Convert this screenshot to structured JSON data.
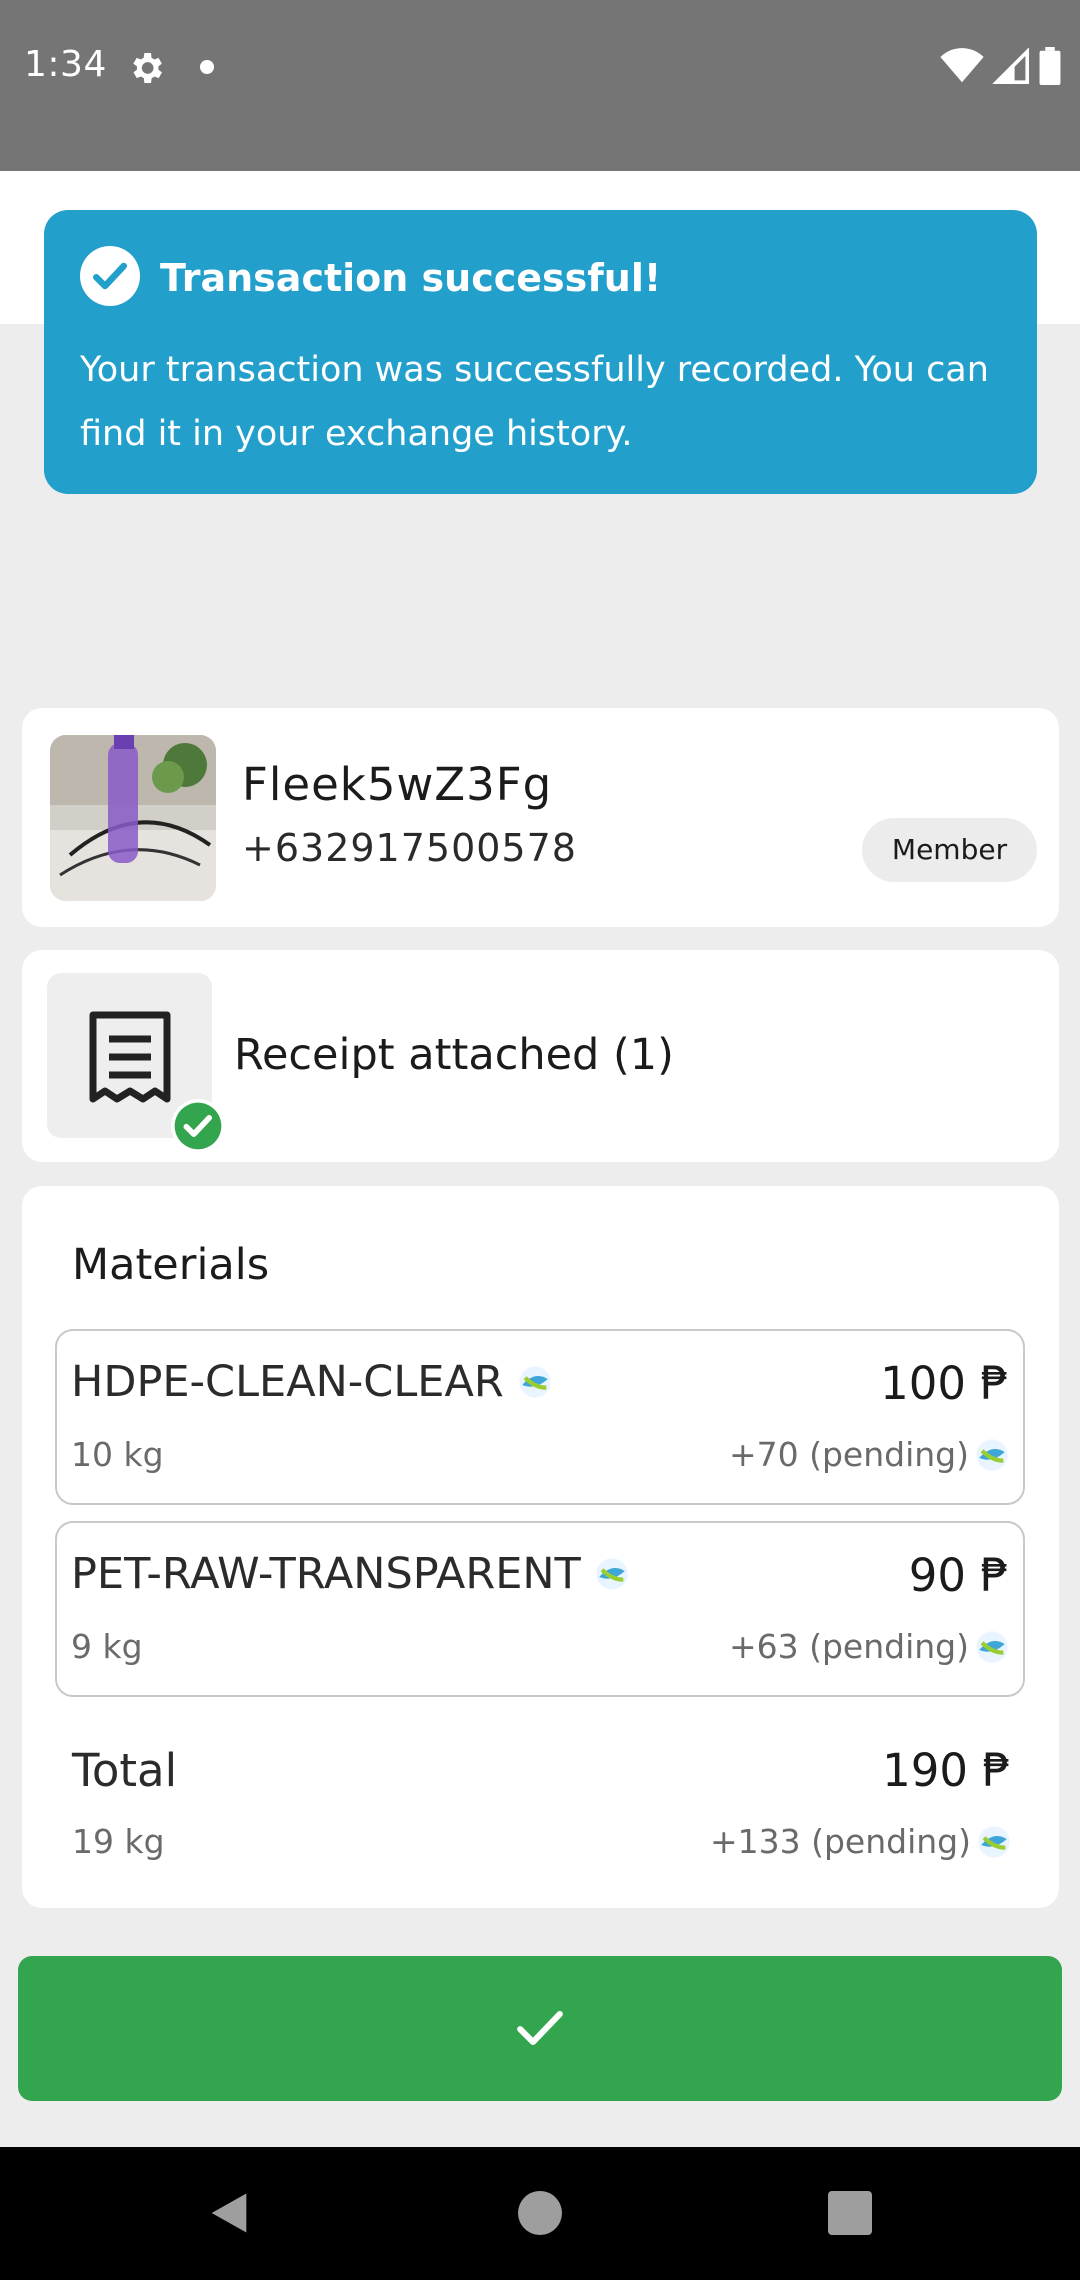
{
  "status_bar": {
    "time": "1:34",
    "icons": [
      "settings-gear-icon",
      "notification-dot-icon",
      "wifi-icon",
      "cellular-signal-icon",
      "battery-icon"
    ]
  },
  "toast": {
    "icon": "check-circle-icon",
    "title": "Transaction successful!",
    "body": "Your transaction was successfully recorded. You can find it in your exchange history.",
    "color": "#239fcc"
  },
  "member": {
    "name": "Fleek5wZ3Fg",
    "phone": "+632917500578",
    "badge": "Member"
  },
  "receipt": {
    "icon": "receipt-icon",
    "status_icon": "check-circle-icon",
    "label": "Receipt attached (1)"
  },
  "materials": {
    "title": "Materials",
    "items": [
      {
        "name": "HDPE-CLEAN-CLEAR",
        "weight": "10 kg",
        "price": "100 ₱",
        "pending": "+70 (pending)"
      },
      {
        "name": "PET-RAW-TRANSPARENT",
        "weight": "9 kg",
        "price": "90 ₱",
        "pending": "+63 (pending)"
      }
    ],
    "total": {
      "label": "Total",
      "weight": "19 kg",
      "price": "190 ₱",
      "pending": "+133 (pending)"
    }
  },
  "confirm_button": {
    "icon": "checkmark-icon",
    "color": "#34a54f"
  },
  "nav_bar": {
    "icons": [
      "back-icon",
      "home-icon",
      "recent-apps-icon"
    ]
  }
}
